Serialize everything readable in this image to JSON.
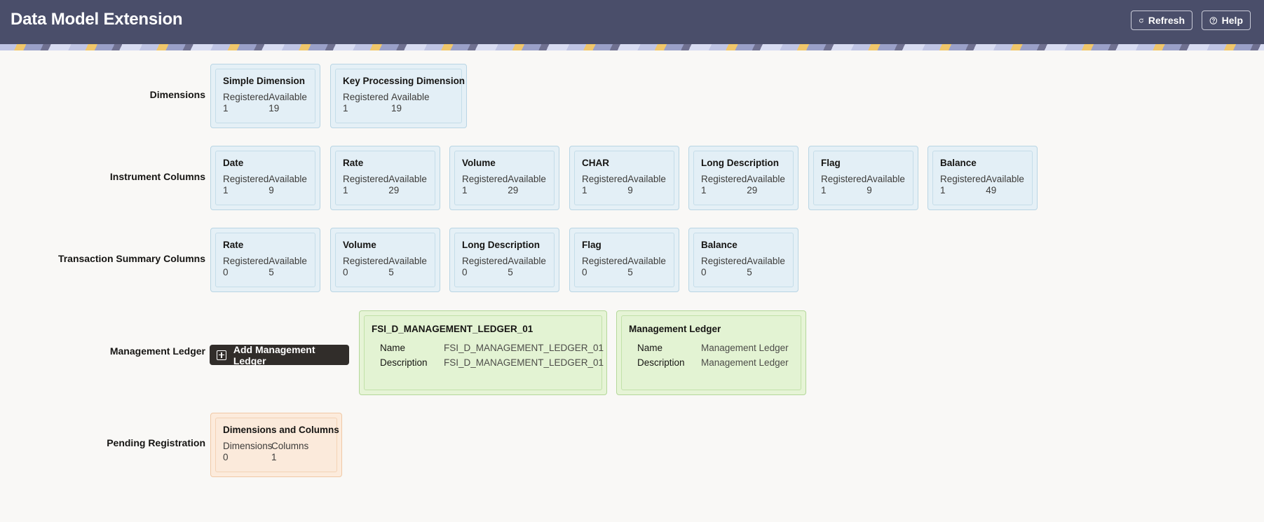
{
  "header": {
    "title": "Data Model Extension",
    "refresh_label": "Refresh",
    "help_label": "Help"
  },
  "rows": {
    "dimensions": "Dimensions",
    "instrument_columns": "Instrument Columns",
    "transaction_summary_columns": "Transaction Summary Columns",
    "management_ledger": "Management Ledger",
    "pending_registration": "Pending Registration"
  },
  "stat_labels": {
    "registered": "Registered",
    "available": "Available"
  },
  "dimensions": [
    {
      "title": "Simple Dimension",
      "registered": "1",
      "available": "19"
    },
    {
      "title": "Key Processing Dimension",
      "registered": "1",
      "available": "19"
    }
  ],
  "instrument_columns": [
    {
      "title": "Date",
      "registered": "1",
      "available": "9"
    },
    {
      "title": "Rate",
      "registered": "1",
      "available": "29"
    },
    {
      "title": "Volume",
      "registered": "1",
      "available": "29"
    },
    {
      "title": "CHAR",
      "registered": "1",
      "available": "9"
    },
    {
      "title": "Long Description",
      "registered": "1",
      "available": "29"
    },
    {
      "title": "Flag",
      "registered": "1",
      "available": "9"
    },
    {
      "title": "Balance",
      "registered": "1",
      "available": "49"
    }
  ],
  "transaction_summary_columns": [
    {
      "title": "Rate",
      "registered": "0",
      "available": "5"
    },
    {
      "title": "Volume",
      "registered": "0",
      "available": "5"
    },
    {
      "title": "Long Description",
      "registered": "0",
      "available": "5"
    },
    {
      "title": "Flag",
      "registered": "0",
      "available": "5"
    },
    {
      "title": "Balance",
      "registered": "0",
      "available": "5"
    }
  ],
  "management_ledger": {
    "add_button_label": "Add Management Ledger",
    "name_label": "Name",
    "description_label": "Description",
    "ledgers": [
      {
        "title": "FSI_D_MANAGEMENT_LEDGER_01",
        "name": "FSI_D_MANAGEMENT_LEDGER_01",
        "description": "FSI_D_MANAGEMENT_LEDGER_01"
      },
      {
        "title": "Management Ledger",
        "name": "Management Ledger",
        "description": "Management Ledger"
      }
    ]
  },
  "pending_registration": {
    "title": "Dimensions and Columns",
    "dimensions_label": "Dimensions",
    "columns_label": "Columns",
    "dimensions_value": "0",
    "columns_value": "1"
  },
  "icons": {
    "refresh": "refresh-icon",
    "help": "help-icon",
    "add": "add-icon"
  }
}
